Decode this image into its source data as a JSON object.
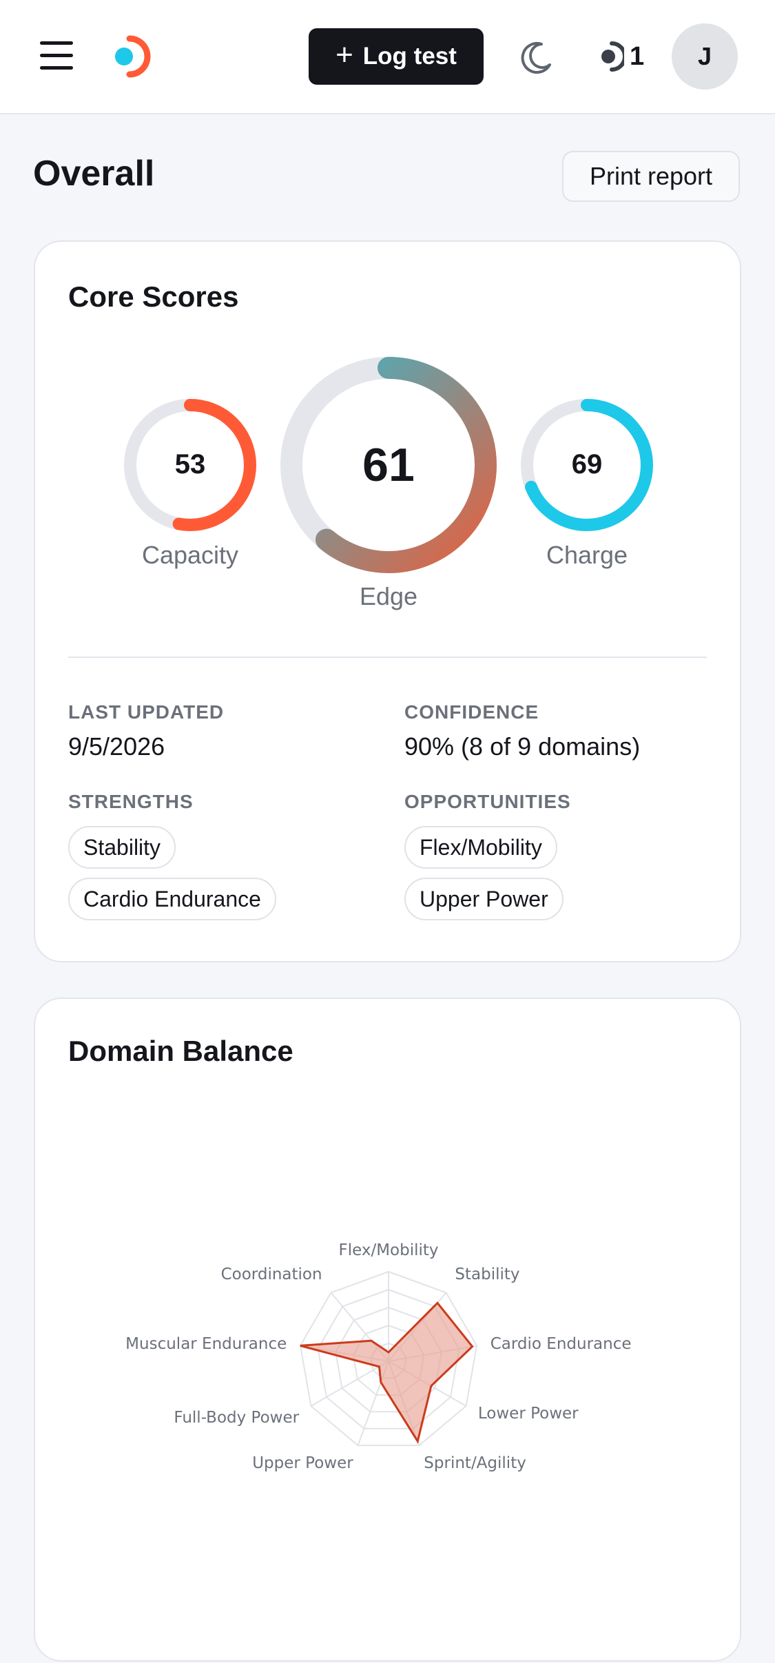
{
  "header": {
    "menu_icon": "menu-icon",
    "logo_icon": "brand-logo",
    "log_test_label": "Log test",
    "theme_icon": "moon-icon",
    "streak_icon": "streak-icon",
    "streak_count": "1",
    "avatar_initial": "J"
  },
  "page": {
    "title": "Overall",
    "print_label": "Print report"
  },
  "core_scores": {
    "title": "Core Scores",
    "capacity": {
      "label": "Capacity",
      "value": "53",
      "fraction": 0.53,
      "color": "#ff5a36"
    },
    "edge": {
      "label": "Edge",
      "value": "61",
      "fraction": 0.61,
      "color_start": "#e5603f",
      "color_end": "#3bb6c9"
    },
    "charge": {
      "label": "Charge",
      "value": "69",
      "fraction": 0.69,
      "color": "#1ec8e8"
    },
    "last_updated_label": "LAST UPDATED",
    "last_updated_value": "9/5/2026",
    "confidence_label": "CONFIDENCE",
    "confidence_value": "90% (8 of 9 domains)",
    "strengths_label": "STRENGTHS",
    "strengths": [
      "Stability",
      "Cardio Endurance"
    ],
    "opportunities_label": "OPPORTUNITIES",
    "opportunities": [
      "Flex/Mobility",
      "Upper Power"
    ]
  },
  "domain_balance": {
    "title": "Domain Balance",
    "chart_data": {
      "type": "radar",
      "categories": [
        "Flex/Mobility",
        "Stability",
        "Cardio Endurance",
        "Lower Power",
        "Sprint/Agility",
        "Upper Power",
        "Full-Body Power",
        "Muscular Endurance",
        "Coordination"
      ],
      "values": [
        10,
        85,
        95,
        55,
        95,
        25,
        12,
        100,
        30
      ],
      "range": [
        0,
        100
      ],
      "rings": 5,
      "fill_color": "#e8a595",
      "stroke_color": "#cc3a1c"
    }
  }
}
